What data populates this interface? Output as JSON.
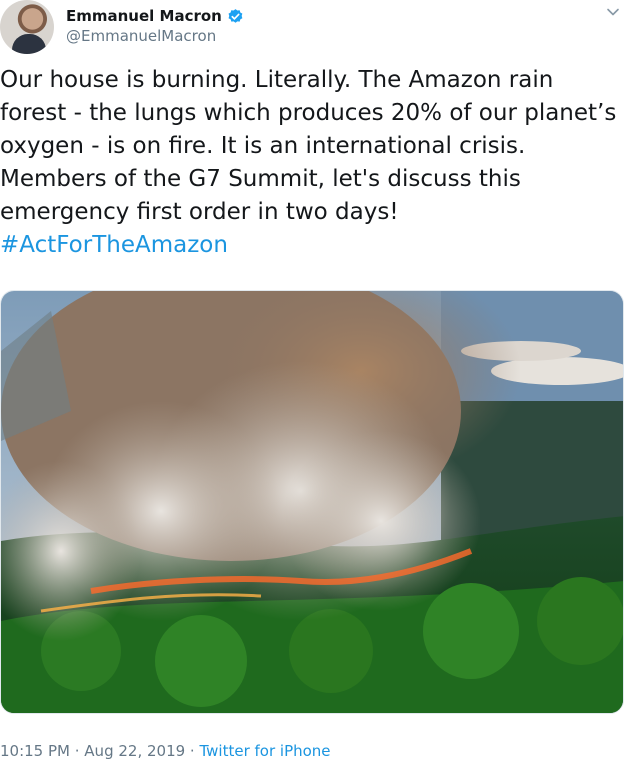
{
  "tweet": {
    "author": {
      "display_name": "Emmanuel Macron",
      "handle": "@EmmanuelMacron",
      "verified": true
    },
    "text": "Our house is burning. Literally. The Amazon rain forest - the lungs which produces 20% of our planet’s oxygen - is on fire. It is an international crisis. Members of the G7 Summit, let's discuss this emergency first order in two days!",
    "hashtag": "#ActForTheAmazon",
    "media": {
      "description": "Aerial photo of Amazon rainforest burning with large smoke plumes"
    },
    "meta": {
      "time": "10:15 PM",
      "separator1": " · ",
      "date": "Aug 22, 2019",
      "separator2": " · ",
      "source": "Twitter for iPhone"
    }
  },
  "icons": {
    "verified": "verified-badge-icon",
    "more": "chevron-down-icon"
  },
  "colors": {
    "link": "#1b95e0",
    "secondary_text": "#657786",
    "verified": "#1da1f2"
  }
}
